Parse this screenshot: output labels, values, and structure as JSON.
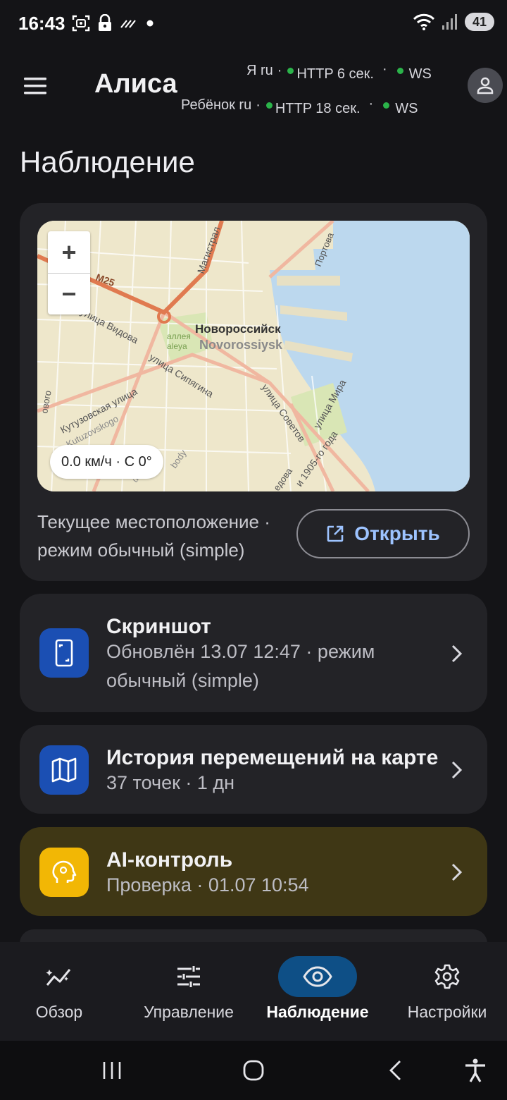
{
  "status_bar": {
    "time": "16:43",
    "battery": "41",
    "icons": [
      "face-scan-icon",
      "lock-icon",
      "signal-hatch-icon",
      "dot-icon",
      "wifi-icon",
      "cell-signal-icon"
    ]
  },
  "header": {
    "title": "Алиса",
    "connections": [
      {
        "name": "Я ru",
        "http": "HTTP 6 сек.",
        "ws": "WS"
      },
      {
        "name": "Ребёнок ru",
        "http": "HTTP 18 сек.",
        "ws": "WS"
      }
    ],
    "sep": "·",
    "status_color": "#2bb34a"
  },
  "page": {
    "title": "Наблюдение"
  },
  "map_card": {
    "zoom_in": "+",
    "zoom_out": "−",
    "speed": "0.0 км/ч · С 0°",
    "caption": "Текущее местоположение · режим обычный (simple)",
    "open_label": "Открыть",
    "labels": {
      "city_ru": "Новороссийск",
      "city_en": "Novorossiysk",
      "road_m25": "M25",
      "magistral": "Магистрал",
      "vidova": "улица Видова",
      "alleya": "аллея",
      "alleya_en": "aleya",
      "sipyagina": "улица Сипягина",
      "kutuzovskaya": "Кутузовская улица",
      "kutuzovskogo": "Kutuzovskogo",
      "sovetov": "улица Советов",
      "mira": "улица Мира",
      "year1905": "и 1905-го года",
      "portovaya": "Портова",
      "novo": "ового",
      "vodova": "едова",
      "body": "body",
      "uliza": "ulitsa"
    }
  },
  "cards": [
    {
      "title": "Скриншот",
      "subtitle": "Обновлён 13.07 12:47 · режим обычный (simple)",
      "icon": "phone-screenshot-icon"
    },
    {
      "title": "История перемещений на карте",
      "subtitle": "37 точек · 1 дн",
      "icon": "map-icon"
    },
    {
      "title": "AI-контроль",
      "subtitle": "Проверка · 01.07 10:54",
      "icon": "ai-head-icon"
    }
  ],
  "bottom_nav": [
    {
      "label": "Обзор",
      "icon": "sparkline-icon",
      "active": false
    },
    {
      "label": "Управление",
      "icon": "sliders-icon",
      "active": false
    },
    {
      "label": "Наблюдение",
      "icon": "eye-icon",
      "active": true
    },
    {
      "label": "Настройки",
      "icon": "gear-icon",
      "active": false
    }
  ],
  "colors": {
    "accent": "#9dc3ff",
    "active_nav": "#0e4f86",
    "tile_blue": "#1b4fb3",
    "tile_yellow": "#f2b705",
    "ai_card": "#3f3715"
  }
}
